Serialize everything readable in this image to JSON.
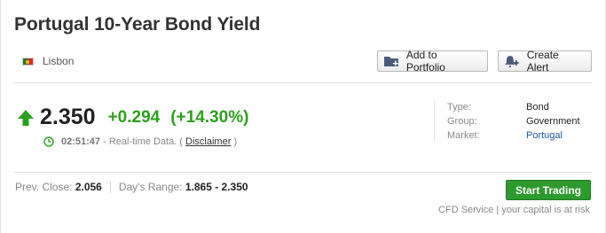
{
  "header": {
    "title": "Portugal 10-Year Bond Yield"
  },
  "location": {
    "label": "Lisbon",
    "flag_icon": "portugal-flag-icon"
  },
  "actions": {
    "portfolio_label": "Add to Portfolio",
    "alert_label": "Create Alert"
  },
  "quote": {
    "direction": "up",
    "price": "2.350",
    "change": "+0.294",
    "change_pct": "(+14.30%)",
    "time": "02:51:47",
    "realtime_text": "- Real-time Data. (",
    "disclaimer": "Disclaimer",
    "close_paren": ")",
    "positive_color": "#2ca01c"
  },
  "info": {
    "type_label": "Type:",
    "type_value": "Bond",
    "group_label": "Group:",
    "group_value": "Government",
    "market_label": "Market:",
    "market_value": "Portugal"
  },
  "stats": {
    "prev_close_label": "Prev. Close:",
    "prev_close_value": "2.056",
    "range_label": "Day's Range:",
    "range_value": "1.865 - 2.350"
  },
  "trading": {
    "button_label": "Start Trading",
    "cfd_text": "CFD Service | your capital is at risk",
    "button_color": "#2d9a2d"
  }
}
